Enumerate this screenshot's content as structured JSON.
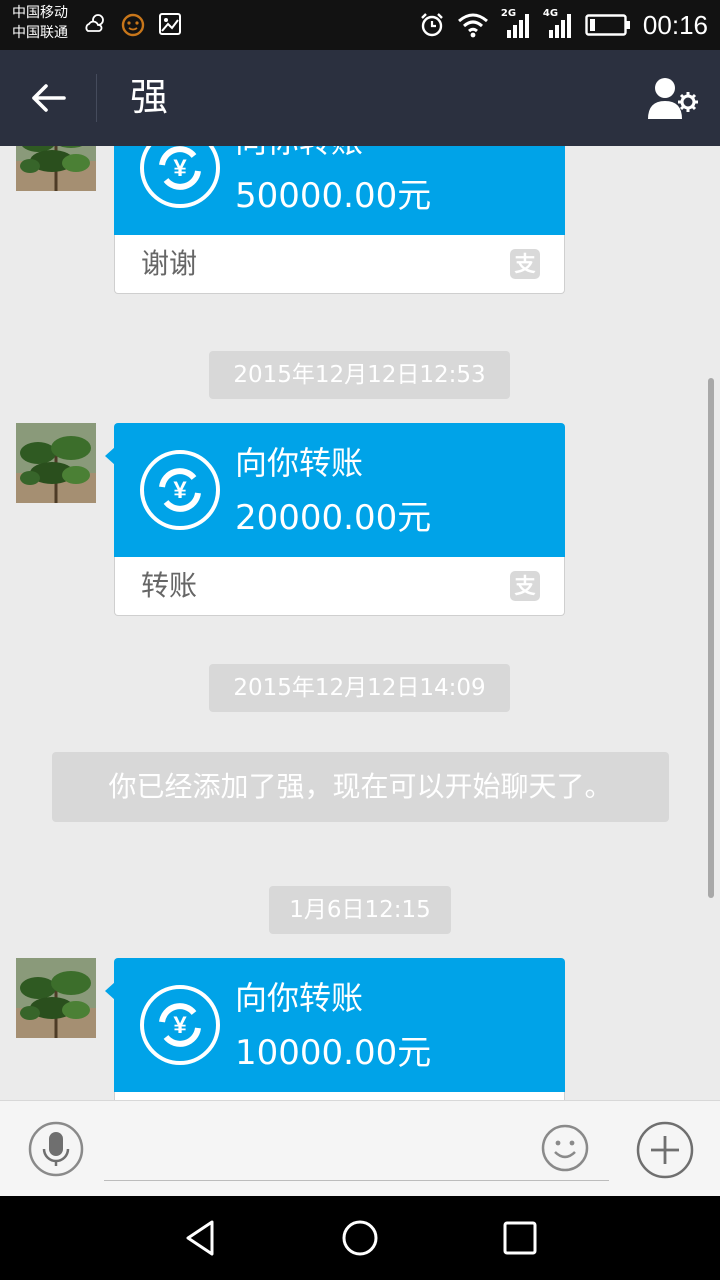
{
  "status_bar": {
    "carrier_1": "中国移动",
    "carrier_2": "中国联通",
    "net_1": "2G",
    "net_2": "4G",
    "time": "00:16"
  },
  "header": {
    "title": "强",
    "back_icon": "arrow-left-icon",
    "profile_icon": "contact-settings-icon"
  },
  "messages": [
    {
      "kind": "transfer",
      "label": "向你转账",
      "amount": "50000.00元",
      "note": "谢谢"
    },
    {
      "kind": "timestamp",
      "text": "2015年12月12日12:53"
    },
    {
      "kind": "transfer",
      "label": "向你转账",
      "amount": "20000.00元",
      "note": "转账"
    },
    {
      "kind": "timestamp",
      "text": "2015年12月12日14:09"
    },
    {
      "kind": "system",
      "text": "你已经添加了强，现在可以开始聊天了。"
    },
    {
      "kind": "timestamp",
      "text": "1月6日12:15"
    },
    {
      "kind": "transfer",
      "label": "向你转账",
      "amount": "10000.00元",
      "note": ""
    }
  ],
  "input_bar": {
    "voice_icon": "microphone-icon",
    "text": "",
    "emoji_icon": "smiley-icon",
    "plus_icon": "plus-icon"
  },
  "colors": {
    "header_bg": "#2b303f",
    "card_blue": "#00a3e8",
    "chat_bg": "#ebebeb",
    "pill_bg": "#d8d8d8"
  }
}
